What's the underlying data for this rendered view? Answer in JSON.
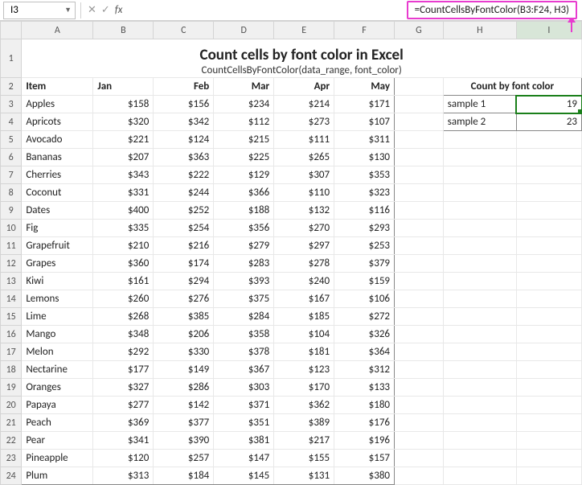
{
  "nameBox": "I3",
  "formulaShown": "=CountCellsByFontColor(B3:F24, H3)",
  "title": "Count cells by font color in Excel",
  "subtitle": "CountCellsByFontColor(data_range, font_color)",
  "columns": [
    "A",
    "B",
    "C",
    "D",
    "E",
    "F",
    "G",
    "H",
    "I"
  ],
  "headers": {
    "item": "Item",
    "months": [
      "Jan",
      "Feb",
      "Mar",
      "Apr",
      "May"
    ]
  },
  "countHeader": "Count by font color",
  "samples": [
    {
      "label": "sample 1",
      "color": "c-orange",
      "value": "19"
    },
    {
      "label": "sample 2",
      "color": "c-green",
      "value": "23"
    }
  ],
  "rows": [
    {
      "n": 3,
      "item": "Apples",
      "v": [
        {
          "t": "$158",
          "c": "c-black"
        },
        {
          "t": "$156",
          "c": "c-black"
        },
        {
          "t": "$234",
          "c": "c-black"
        },
        {
          "t": "$214",
          "c": "c-black"
        },
        {
          "t": "$171",
          "c": "c-black"
        }
      ]
    },
    {
      "n": 4,
      "item": "Apricots",
      "v": [
        {
          "t": "$320",
          "c": "c-black"
        },
        {
          "t": "$342",
          "c": "c-black"
        },
        {
          "t": "$112",
          "c": "c-orange"
        },
        {
          "t": "$273",
          "c": "c-black"
        },
        {
          "t": "$107",
          "c": "c-orange"
        }
      ]
    },
    {
      "n": 5,
      "item": "Avocado",
      "v": [
        {
          "t": "$221",
          "c": "c-black"
        },
        {
          "t": "$124",
          "c": "c-orange"
        },
        {
          "t": "$215",
          "c": "c-black"
        },
        {
          "t": "$111",
          "c": "c-orange"
        },
        {
          "t": "$311",
          "c": "c-black"
        }
      ]
    },
    {
      "n": 6,
      "item": "Bananas",
      "v": [
        {
          "t": "$207",
          "c": "c-black"
        },
        {
          "t": "$363",
          "c": "c-green"
        },
        {
          "t": "$225",
          "c": "c-black"
        },
        {
          "t": "$265",
          "c": "c-black"
        },
        {
          "t": "$130",
          "c": "c-orange"
        }
      ]
    },
    {
      "n": 7,
      "item": "Cherries",
      "v": [
        {
          "t": "$343",
          "c": "c-black"
        },
        {
          "t": "$222",
          "c": "c-black"
        },
        {
          "t": "$129",
          "c": "c-orange"
        },
        {
          "t": "$307",
          "c": "c-black"
        },
        {
          "t": "$353",
          "c": "c-green"
        }
      ]
    },
    {
      "n": 8,
      "item": "Coconut",
      "v": [
        {
          "t": "$331",
          "c": "c-black"
        },
        {
          "t": "$244",
          "c": "c-black"
        },
        {
          "t": "$366",
          "c": "c-green"
        },
        {
          "t": "$110",
          "c": "c-orange"
        },
        {
          "t": "$323",
          "c": "c-black"
        }
      ]
    },
    {
      "n": 9,
      "item": "Dates",
      "v": [
        {
          "t": "$400",
          "c": "c-green"
        },
        {
          "t": "$252",
          "c": "c-black"
        },
        {
          "t": "$188",
          "c": "c-black"
        },
        {
          "t": "$132",
          "c": "c-orange"
        },
        {
          "t": "$116",
          "c": "c-orange"
        }
      ]
    },
    {
      "n": 10,
      "item": "Fig",
      "v": [
        {
          "t": "$335",
          "c": "c-black"
        },
        {
          "t": "$254",
          "c": "c-black"
        },
        {
          "t": "$356",
          "c": "c-green"
        },
        {
          "t": "$270",
          "c": "c-black"
        },
        {
          "t": "$293",
          "c": "c-black"
        }
      ]
    },
    {
      "n": 11,
      "item": "Grapefruit",
      "v": [
        {
          "t": "$210",
          "c": "c-black"
        },
        {
          "t": "$216",
          "c": "c-black"
        },
        {
          "t": "$279",
          "c": "c-black"
        },
        {
          "t": "$297",
          "c": "c-black"
        },
        {
          "t": "$253",
          "c": "c-black"
        }
      ]
    },
    {
      "n": 12,
      "item": "Grapes",
      "v": [
        {
          "t": "$360",
          "c": "c-green"
        },
        {
          "t": "$174",
          "c": "c-black"
        },
        {
          "t": "$283",
          "c": "c-black"
        },
        {
          "t": "$278",
          "c": "c-black"
        },
        {
          "t": "$379",
          "c": "c-green"
        }
      ]
    },
    {
      "n": 13,
      "item": "Kiwi",
      "v": [
        {
          "t": "$161",
          "c": "c-black"
        },
        {
          "t": "$294",
          "c": "c-black"
        },
        {
          "t": "$393",
          "c": "c-green"
        },
        {
          "t": "$240",
          "c": "c-black"
        },
        {
          "t": "$159",
          "c": "c-black"
        }
      ]
    },
    {
      "n": 14,
      "item": "Lemons",
      "v": [
        {
          "t": "$260",
          "c": "c-black"
        },
        {
          "t": "$276",
          "c": "c-black"
        },
        {
          "t": "$375",
          "c": "c-green"
        },
        {
          "t": "$167",
          "c": "c-black"
        },
        {
          "t": "$106",
          "c": "c-orange"
        }
      ]
    },
    {
      "n": 15,
      "item": "Lime",
      "v": [
        {
          "t": "$268",
          "c": "c-black"
        },
        {
          "t": "$385",
          "c": "c-green"
        },
        {
          "t": "$284",
          "c": "c-black"
        },
        {
          "t": "$185",
          "c": "c-black"
        },
        {
          "t": "$272",
          "c": "c-black"
        }
      ]
    },
    {
      "n": 16,
      "item": "Mango",
      "v": [
        {
          "t": "$348",
          "c": "c-black"
        },
        {
          "t": "$206",
          "c": "c-black"
        },
        {
          "t": "$358",
          "c": "c-green"
        },
        {
          "t": "$104",
          "c": "c-orange"
        },
        {
          "t": "$326",
          "c": "c-black"
        }
      ]
    },
    {
      "n": 17,
      "item": "Melon",
      "v": [
        {
          "t": "$292",
          "c": "c-black"
        },
        {
          "t": "$330",
          "c": "c-black"
        },
        {
          "t": "$378",
          "c": "c-green"
        },
        {
          "t": "$181",
          "c": "c-black"
        },
        {
          "t": "$364",
          "c": "c-green"
        }
      ]
    },
    {
      "n": 18,
      "item": "Nectarine",
      "v": [
        {
          "t": "$177",
          "c": "c-black"
        },
        {
          "t": "$149",
          "c": "c-orange"
        },
        {
          "t": "$367",
          "c": "c-green"
        },
        {
          "t": "$123",
          "c": "c-orange"
        },
        {
          "t": "$312",
          "c": "c-black"
        }
      ]
    },
    {
      "n": 19,
      "item": "Oranges",
      "v": [
        {
          "t": "$327",
          "c": "c-black"
        },
        {
          "t": "$286",
          "c": "c-black"
        },
        {
          "t": "$303",
          "c": "c-black"
        },
        {
          "t": "$170",
          "c": "c-black"
        },
        {
          "t": "$133",
          "c": "c-orange"
        }
      ]
    },
    {
      "n": 20,
      "item": "Papaya",
      "v": [
        {
          "t": "$277",
          "c": "c-black"
        },
        {
          "t": "$142",
          "c": "c-orange"
        },
        {
          "t": "$371",
          "c": "c-green"
        },
        {
          "t": "$362",
          "c": "c-green"
        },
        {
          "t": "$180",
          "c": "c-black"
        }
      ]
    },
    {
      "n": 21,
      "item": "Peach",
      "v": [
        {
          "t": "$369",
          "c": "c-green"
        },
        {
          "t": "$377",
          "c": "c-green"
        },
        {
          "t": "$351",
          "c": "c-green"
        },
        {
          "t": "$389",
          "c": "c-green"
        },
        {
          "t": "$176",
          "c": "c-black"
        }
      ]
    },
    {
      "n": 22,
      "item": "Pear",
      "v": [
        {
          "t": "$341",
          "c": "c-black"
        },
        {
          "t": "$390",
          "c": "c-green"
        },
        {
          "t": "$381",
          "c": "c-green"
        },
        {
          "t": "$217",
          "c": "c-black"
        },
        {
          "t": "$196",
          "c": "c-black"
        }
      ]
    },
    {
      "n": 23,
      "item": "Pineapple",
      "v": [
        {
          "t": "$120",
          "c": "c-orange"
        },
        {
          "t": "$257",
          "c": "c-black"
        },
        {
          "t": "$147",
          "c": "c-orange"
        },
        {
          "t": "$155",
          "c": "c-black"
        },
        {
          "t": "$157",
          "c": "c-black"
        }
      ]
    },
    {
      "n": 24,
      "item": "Plum",
      "v": [
        {
          "t": "$313",
          "c": "c-black"
        },
        {
          "t": "$184",
          "c": "c-black"
        },
        {
          "t": "$145",
          "c": "c-orange"
        },
        {
          "t": "$131",
          "c": "c-orange"
        },
        {
          "t": "$380",
          "c": "c-green"
        }
      ]
    }
  ]
}
